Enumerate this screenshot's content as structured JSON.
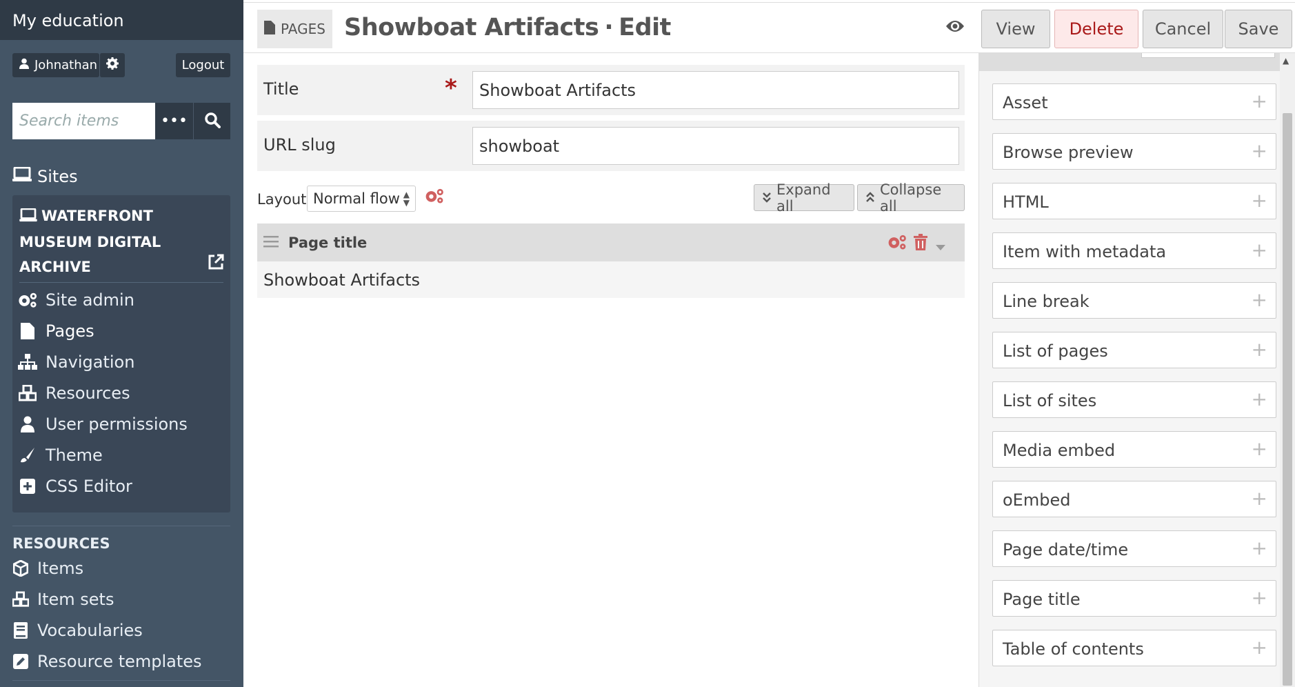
{
  "sidebar": {
    "brand": "My education",
    "user_name": "Johnathan",
    "logout_label": "Logout",
    "search_placeholder": "Search items",
    "search_more_label": "•••",
    "sites_heading": "Sites",
    "site_name": "WATERFRONT MUSEUM DIGITAL ARCHIVE",
    "site_nav": [
      {
        "label": "Site admin",
        "icon": "gears-icon"
      },
      {
        "label": "Pages",
        "icon": "file-icon",
        "active": true
      },
      {
        "label": "Navigation",
        "icon": "sitemap-icon"
      },
      {
        "label": "Resources",
        "icon": "cubes-icon"
      },
      {
        "label": "User permissions",
        "icon": "user-icon"
      },
      {
        "label": "Theme",
        "icon": "paintbrush-icon"
      },
      {
        "label": "CSS Editor",
        "icon": "plus-square-icon"
      }
    ],
    "resources_heading": "RESOURCES",
    "resources": [
      {
        "label": "Items",
        "icon": "cube-icon"
      },
      {
        "label": "Item sets",
        "icon": "cubes-icon"
      },
      {
        "label": "Vocabularies",
        "icon": "book-icon"
      },
      {
        "label": "Resource templates",
        "icon": "edit-icon"
      }
    ]
  },
  "header": {
    "section_badge": "PAGES",
    "page_name": "Showboat Artifacts",
    "separator": "·",
    "mode": "Edit",
    "buttons": {
      "view": "View",
      "delete": "Delete",
      "cancel": "Cancel",
      "save": "Save"
    }
  },
  "form": {
    "title_label": "Title",
    "required_mark": "*",
    "title_value": "Showboat Artifacts",
    "slug_label": "URL slug",
    "slug_value": "showboat",
    "layout_label": "Layout",
    "layout_value": "Normal flow",
    "expand_all": "Expand all",
    "collapse_all": "Collapse all"
  },
  "block": {
    "title": "Page title",
    "content": "Showboat Artifacts"
  },
  "block_library": [
    "Asset",
    "Browse preview",
    "HTML",
    "Item with metadata",
    "Line break",
    "List of pages",
    "List of sites",
    "Media embed",
    "oEmbed",
    "Page date/time",
    "Page title",
    "Table of contents"
  ],
  "colors": {
    "sidebar_bg": "#445566",
    "sidebar_dark": "#2f3a46",
    "danger": "#a91919",
    "accent_icon": "#d06060"
  }
}
